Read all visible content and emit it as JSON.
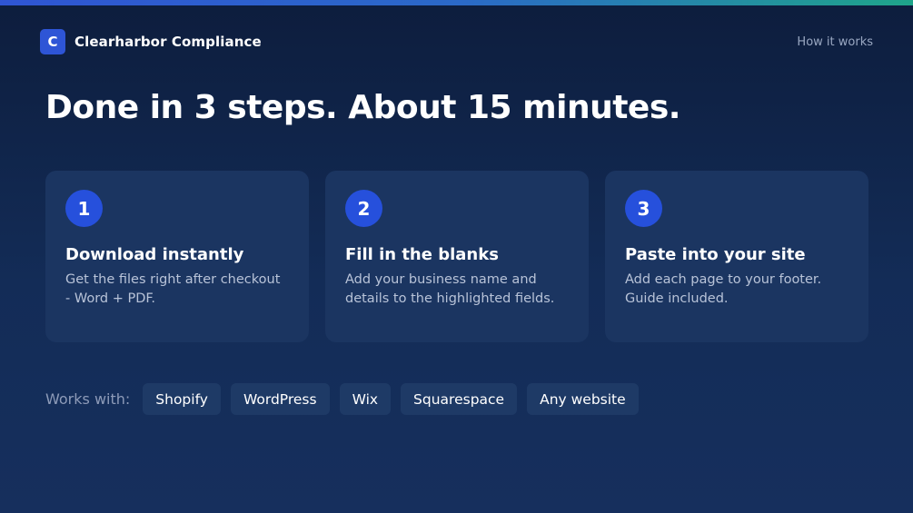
{
  "brand": {
    "logo_letter": "C",
    "name": "Clearharbor Compliance"
  },
  "nav": {
    "how_it_works": "How it works"
  },
  "headline": "Done in 3 steps. About 15 minutes.",
  "steps": [
    {
      "number": "1",
      "title": "Download instantly",
      "description": "Get the files right after checkout - Word + PDF."
    },
    {
      "number": "2",
      "title": "Fill in the blanks",
      "description": "Add your business name and details to the highlighted fields."
    },
    {
      "number": "3",
      "title": "Paste into your site",
      "description": "Add each page to your footer. Guide included."
    }
  ],
  "works_with": {
    "label": "Works with:",
    "platforms": [
      "Shopify",
      "WordPress",
      "Wix",
      "Squarespace",
      "Any website"
    ]
  },
  "colors": {
    "background": "#0f2347",
    "card": "#1b3561",
    "accent_blue": "#2650dc",
    "top_bar_start": "#2f55d4",
    "top_bar_end": "#1fa58a"
  }
}
